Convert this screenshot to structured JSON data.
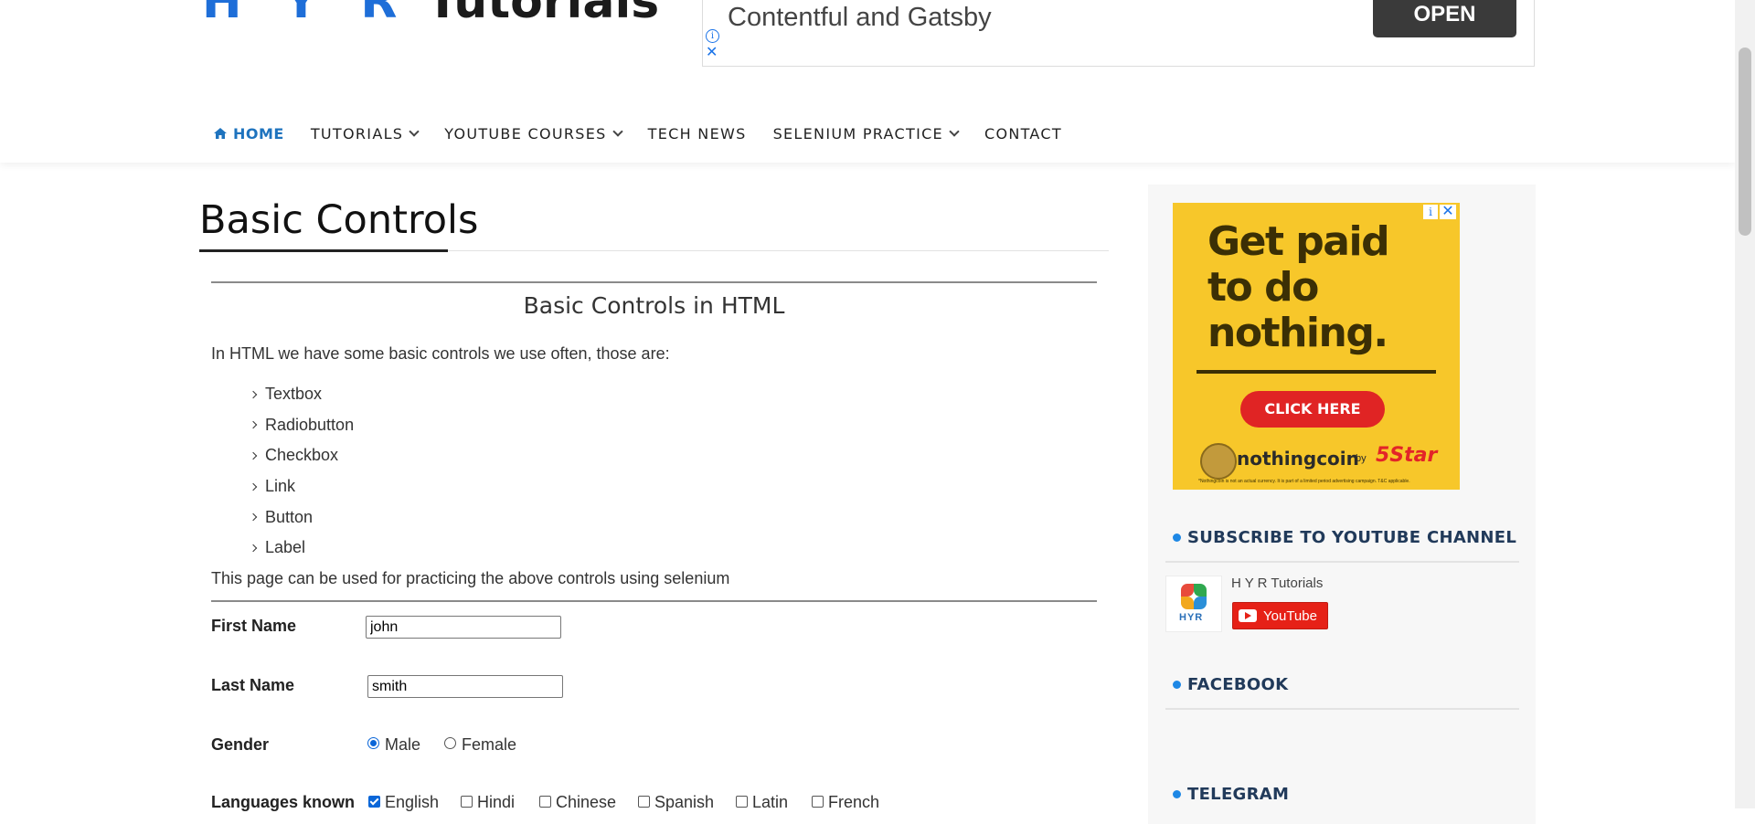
{
  "site": {
    "logo_hyr": "H Y R",
    "logo_tutorials": "Tutorials"
  },
  "top_ad": {
    "title": "Contentful and Gatsby",
    "button": "OPEN"
  },
  "nav": {
    "home": "HOME",
    "tutorials": "TUTORIALS",
    "youtube_courses": "YOUTUBE COURSES",
    "tech_news": "TECH NEWS",
    "selenium_practice": "SELENIUM PRACTICE",
    "contact": "CONTACT"
  },
  "main": {
    "page_title": "Basic Controls",
    "section_title": "Basic Controls in HTML",
    "intro": "In HTML we have some basic controls we use often, those are:",
    "controls": [
      "Textbox",
      "Radiobutton",
      "Checkbox",
      "Link",
      "Button",
      "Label"
    ],
    "practice_note": "This page can be used for practicing the above controls using selenium"
  },
  "form": {
    "first_name_label": "First Name",
    "first_name_value": "john",
    "last_name_label": "Last Name",
    "last_name_value": "smith",
    "gender_label": "Gender",
    "gender_male": "Male",
    "gender_female": "Female",
    "gender_selected": "Male",
    "languages_label": "Languages known",
    "languages": [
      {
        "name": "English",
        "checked": true
      },
      {
        "name": "Hindi",
        "checked": false
      },
      {
        "name": "Chinese",
        "checked": false
      },
      {
        "name": "Spanish",
        "checked": false
      },
      {
        "name": "Latin",
        "checked": false
      },
      {
        "name": "French",
        "checked": false
      }
    ]
  },
  "sidebar": {
    "ad": {
      "headline": "Get paid to do nothing.",
      "cta": "CLICK HERE",
      "brand": "nothingcoin",
      "by": "by",
      "partner": "5Star",
      "fine_print": "*Nothingcoin is not an actual currency. It is part of a limited period advertising campaign. T&C applicable."
    },
    "subscribe_title": "SUBSCRIBE TO YOUTUBE CHANNEL",
    "channel_name": "H Y R Tutorials",
    "channel_logo_text": "HYR",
    "youtube_button": "YouTube",
    "facebook_title": "FACEBOOK",
    "telegram_title": "TELEGRAM"
  },
  "colors": {
    "accent": "#1e73be",
    "ad_yellow": "#f7c72a",
    "youtube_red": "#e62117",
    "radio_blue": "#0a66d8"
  }
}
